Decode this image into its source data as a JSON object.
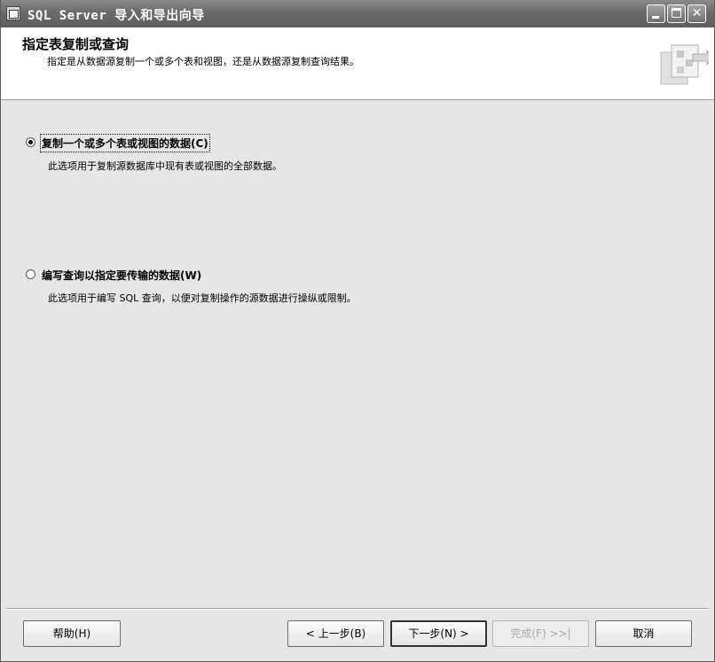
{
  "window": {
    "title": "SQL Server 导入和导出向导"
  },
  "header": {
    "heading": "指定表复制或查询",
    "subheading": "指定是从数据源复制一个或多个表和视图，还是从数据源复制查询结果。"
  },
  "options": [
    {
      "label": "复制一个或多个表或视图的数据(C)",
      "description": "此选项用于复制源数据库中现有表或视图的全部数据。",
      "selected": true
    },
    {
      "label": "编写查询以指定要传输的数据(W)",
      "description": "此选项用于编写 SQL 查询，以便对复制操作的源数据进行操纵或限制。",
      "selected": false
    }
  ],
  "buttons": {
    "help": "帮助(H)",
    "back": "< 上一步(B)",
    "next": "下一步(N) >",
    "finish": "完成(F) >>|",
    "cancel": "取消"
  },
  "icons": {
    "app": "app-window-icon",
    "wizard": "wizard-graphic-icon"
  }
}
